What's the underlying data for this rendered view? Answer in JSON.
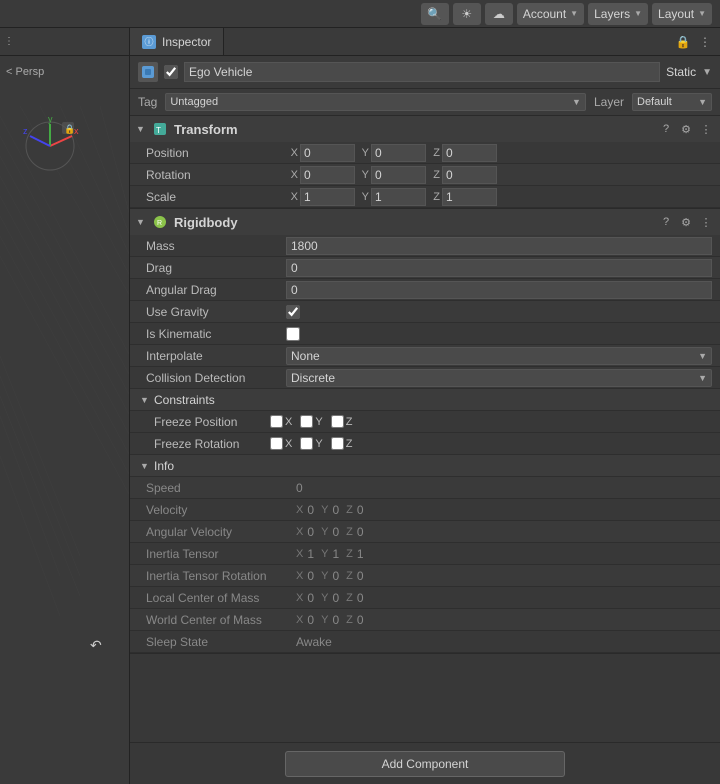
{
  "topbar": {
    "icons": [
      "search",
      "sun",
      "cloud"
    ],
    "account_label": "Account",
    "layers_label": "Layers",
    "layout_label": "Layout"
  },
  "inspector": {
    "tab_label": "Inspector",
    "gameobject": {
      "name": "Ego Vehicle",
      "static_label": "Static",
      "tag_label": "Tag",
      "tag_value": "Untagged",
      "layer_label": "Layer",
      "layer_value": "Default"
    },
    "transform": {
      "title": "Transform",
      "position_label": "Position",
      "rotation_label": "Rotation",
      "scale_label": "Scale",
      "pos_x": "0",
      "pos_y": "0",
      "pos_z": "0",
      "rot_x": "0",
      "rot_y": "0",
      "rot_z": "0",
      "scale_x": "1",
      "scale_y": "1",
      "scale_z": "1"
    },
    "rigidbody": {
      "title": "Rigidbody",
      "mass_label": "Mass",
      "mass_value": "1800",
      "drag_label": "Drag",
      "drag_value": "0",
      "angular_drag_label": "Angular Drag",
      "angular_drag_value": "0",
      "use_gravity_label": "Use Gravity",
      "use_gravity_checked": true,
      "is_kinematic_label": "Is Kinematic",
      "is_kinematic_checked": false,
      "interpolate_label": "Interpolate",
      "interpolate_value": "None",
      "collision_label": "Collision Detection",
      "collision_value": "Discrete",
      "constraints_label": "Constraints",
      "freeze_pos_label": "Freeze Position",
      "freeze_pos_x": false,
      "freeze_pos_y": false,
      "freeze_pos_z": false,
      "freeze_rot_label": "Freeze Rotation",
      "freeze_rot_x": false,
      "freeze_rot_y": false,
      "freeze_rot_z": false
    },
    "info": {
      "title": "Info",
      "speed_label": "Speed",
      "speed_value": "0",
      "velocity_label": "Velocity",
      "vel_x": "0",
      "vel_y": "0",
      "vel_z": "0",
      "angular_velocity_label": "Angular Velocity",
      "ang_vel_x": "0",
      "ang_vel_y": "0",
      "ang_vel_z": "0",
      "inertia_tensor_label": "Inertia Tensor",
      "it_x": "1",
      "it_y": "1",
      "it_z": "1",
      "inertia_tensor_rot_label": "Inertia Tensor Rotation",
      "itr_x": "0",
      "itr_y": "0",
      "itr_z": "0",
      "local_com_label": "Local Center of Mass",
      "lcm_x": "0",
      "lcm_y": "0",
      "lcm_z": "0",
      "world_com_label": "World Center of Mass",
      "wcm_x": "0",
      "wcm_y": "0",
      "wcm_z": "0",
      "sleep_state_label": "Sleep State",
      "sleep_state_value": "Awake"
    },
    "add_component_label": "Add Component"
  }
}
